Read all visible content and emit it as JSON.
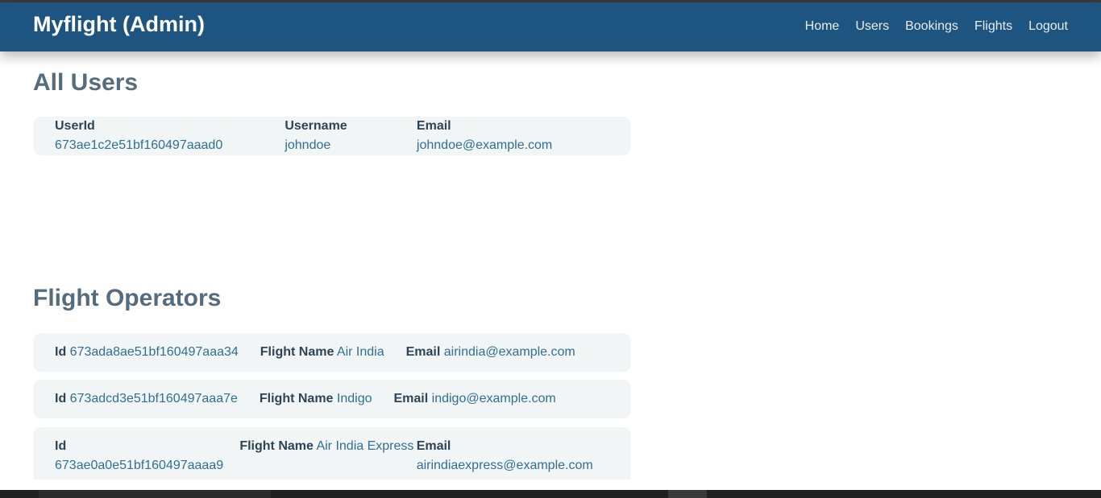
{
  "navbar": {
    "brand": "Myflight (Admin)",
    "links": [
      "Home",
      "Users",
      "Bookings",
      "Flights",
      "Logout"
    ]
  },
  "users_section": {
    "title": "All Users",
    "labels": {
      "id": "UserId",
      "username": "Username",
      "email": "Email"
    },
    "items": [
      {
        "id": "673ae1c2e51bf160497aaad0",
        "username": "johndoe",
        "email": "johndoe@example.com"
      }
    ]
  },
  "operators_section": {
    "title": "Flight Operators",
    "labels": {
      "id": "Id",
      "flight_name": "Flight Name",
      "email": "Email"
    },
    "items": [
      {
        "id": "673ada8ae51bf160497aaa34",
        "flight_name": "Air India",
        "email": "airindia@example.com"
      },
      {
        "id": "673adcd3e51bf160497aaa7e",
        "flight_name": "Indigo",
        "email": "indigo@example.com"
      },
      {
        "id": "673ae0a0e51bf160497aaaa9",
        "flight_name": "Air India Express",
        "email": "airindiaexpress@example.com"
      }
    ]
  }
}
